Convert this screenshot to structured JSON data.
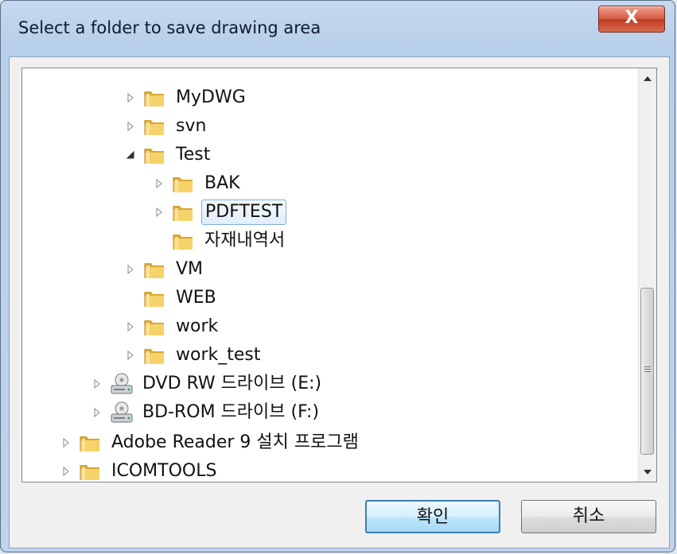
{
  "window": {
    "title": "Select a folder to save drawing area",
    "close_label": "X"
  },
  "tree": {
    "items": [
      {
        "label": "MyDWG",
        "icon": "folder-icon",
        "expander": "collapsed"
      },
      {
        "label": "svn",
        "icon": "folder-icon",
        "expander": "collapsed"
      },
      {
        "label": "Test",
        "icon": "folder-icon",
        "expander": "expanded"
      },
      {
        "label": "BAK",
        "icon": "folder-icon",
        "expander": "collapsed"
      },
      {
        "label": "PDFTEST",
        "icon": "folder-icon",
        "expander": "collapsed",
        "selected": true
      },
      {
        "label": "자재내역서",
        "icon": "folder-icon",
        "expander": "none"
      },
      {
        "label": "VM",
        "icon": "folder-icon",
        "expander": "collapsed"
      },
      {
        "label": "WEB",
        "icon": "folder-icon",
        "expander": "none"
      },
      {
        "label": "work",
        "icon": "folder-icon",
        "expander": "collapsed"
      },
      {
        "label": "work_test",
        "icon": "folder-icon",
        "expander": "collapsed"
      },
      {
        "label": "DVD RW 드라이브 (E:)",
        "icon": "drive-icon",
        "expander": "collapsed"
      },
      {
        "label": "BD-ROM 드라이브 (F:)",
        "icon": "drive-icon",
        "expander": "collapsed"
      },
      {
        "label": "Adobe Reader 9 설치 프로그램",
        "icon": "folder-icon",
        "expander": "collapsed"
      },
      {
        "label": "ICOMTOOLS",
        "icon": "folder-icon",
        "expander": "collapsed"
      }
    ]
  },
  "buttons": {
    "ok_label": "확인",
    "cancel_label": "취소"
  },
  "colors": {
    "selection_border": "#84acdd",
    "folder_yellow": "#f3c94f",
    "ok_border": "#3c7fb1"
  }
}
